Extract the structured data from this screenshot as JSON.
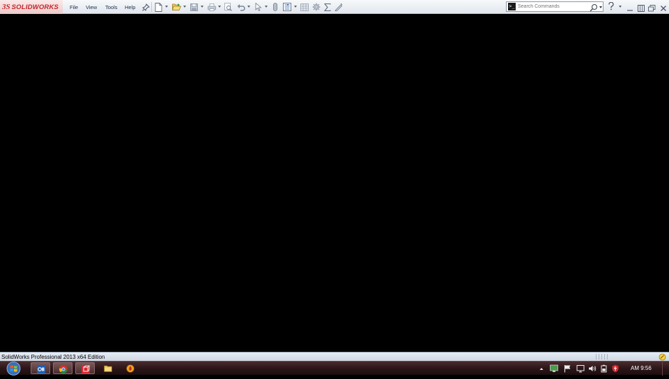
{
  "app": {
    "logo_ds": "3S",
    "logo_brand": "SOLIDWORKS"
  },
  "menu": {
    "items": [
      "File",
      "View",
      "Tools",
      "Help"
    ]
  },
  "toolbar": {
    "icons": [
      "pin-icon",
      "new-document-icon",
      "open-icon",
      "save-icon",
      "print-icon",
      "zoom-icon",
      "undo-icon",
      "select-icon",
      "paperclip-icon",
      "options-icon",
      "table-icon",
      "gear-icon",
      "sum-icon",
      "pencil-icon"
    ]
  },
  "search": {
    "placeholder": "Search Commands",
    "value": ""
  },
  "window_controls": [
    "help-icon",
    "minimize-icon",
    "restore-panel-icon",
    "restore-icon",
    "close-icon"
  ],
  "status": {
    "text": "SolidWorks Professional 2013 x64 Edition"
  },
  "taskbar": {
    "apps": [
      "outlook-icon",
      "chrome-icon",
      "solidworks-icon",
      "explorer-icon",
      "fire-icon"
    ],
    "tray_icons": [
      "show-hidden-icon",
      "network-icon",
      "flag-icon",
      "display-icon",
      "volume-icon",
      "battery-icon",
      "antivirus-icon"
    ],
    "time": "AM 9:56"
  },
  "colors": {
    "brand_red": "#c0262d",
    "canvas": "#000000",
    "taskbar": "#2a1517"
  }
}
